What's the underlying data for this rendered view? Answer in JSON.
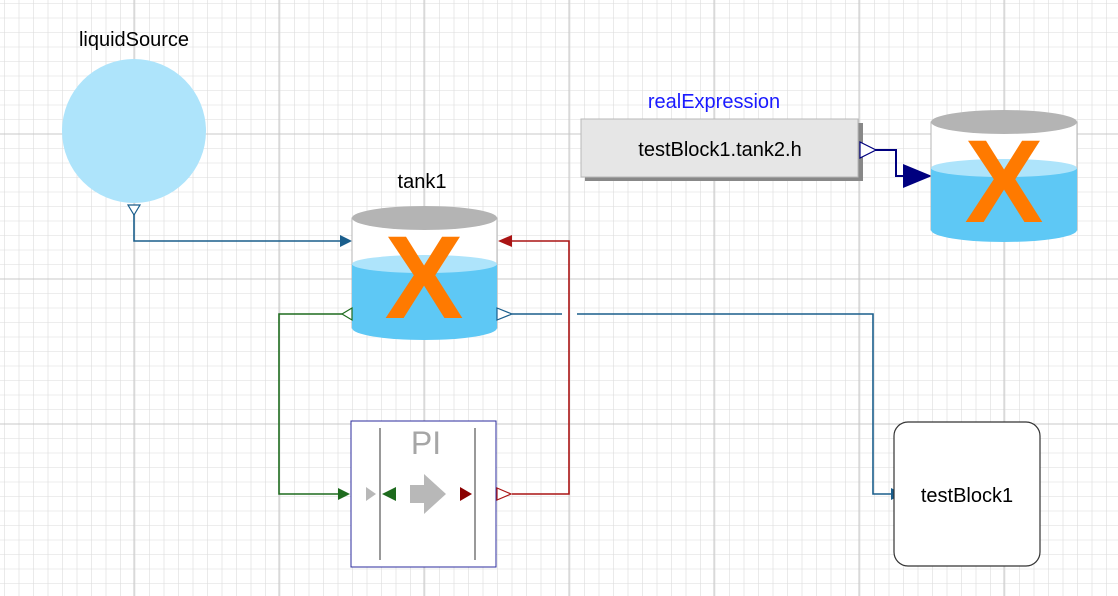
{
  "labels": {
    "liquid_source": "liquidSource",
    "tank1": "tank1",
    "real_expression": "realExpression",
    "real_expression_value": "testBlock1.tank2.h",
    "pi": "PI",
    "test_block": "testBlock1",
    "tank_mark": "X"
  },
  "colors": {
    "grid": "#dcdcdc",
    "grid_major": "#c8c8c8",
    "liquid": "#aee4fb",
    "tank_fill": "#5ec8f5",
    "tank_top": "#b4b4b4",
    "mark": "#ff7a00",
    "flow_line": "#1a5e8c",
    "control_line": "#1e6b1e",
    "measure_line": "#aa1414",
    "signal_line": "#00007f",
    "label_blue": "#1a1aff",
    "pi_border": "#2b2b9c",
    "pi_gray": "#b8b8b8"
  },
  "icons": {
    "liquid_source": "circle-source-icon",
    "tank": "tank-icon",
    "pi": "pi-controller-icon",
    "arrow": "gray-arrow-icon"
  }
}
